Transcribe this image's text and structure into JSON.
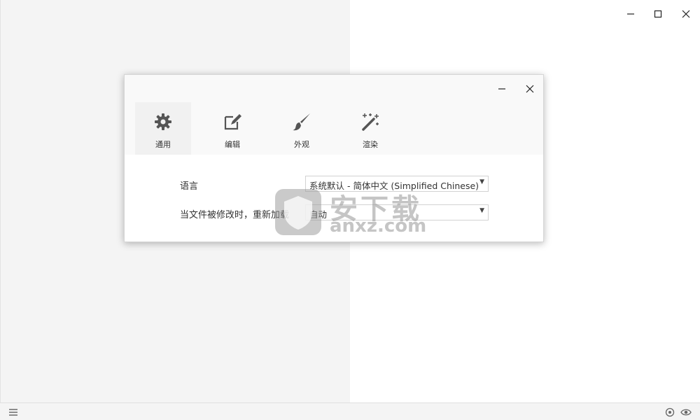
{
  "window": {
    "controls": {
      "minimize_icon": "minimize-icon",
      "maximize_icon": "maximize-icon",
      "close_icon": "close-icon"
    }
  },
  "settings_dialog": {
    "tabs": [
      {
        "label": "通用",
        "icon": "gear-icon",
        "active": true
      },
      {
        "label": "编辑",
        "icon": "edit-icon",
        "active": false
      },
      {
        "label": "外观",
        "icon": "brush-icon",
        "active": false
      },
      {
        "label": "渲染",
        "icon": "magic-wand-icon",
        "active": false
      }
    ],
    "language": {
      "label": "语言",
      "value": "系统默认 - 简体中文 (Simplified Chinese)"
    },
    "reload": {
      "label": "当文件被修改时，重新加载",
      "value": "自动"
    }
  },
  "watermark": {
    "text_cn": "安下载",
    "text_en": "anxz.com"
  },
  "status_bar": {
    "left_icon": "menu-icon",
    "right_icons": [
      "target-icon",
      "eye-icon"
    ]
  }
}
